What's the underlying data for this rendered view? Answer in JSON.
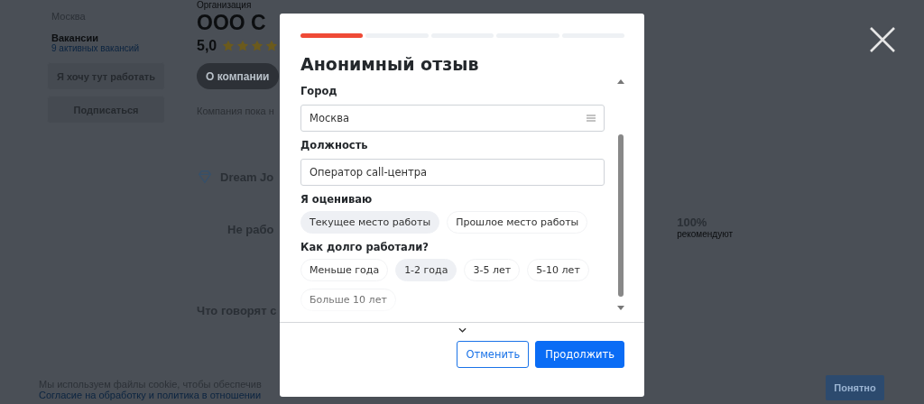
{
  "page": {
    "sidebar": {
      "city": "Москва",
      "vacancies_label": "Вакансии",
      "vacancies_link": "9 активных вакансий",
      "buttons": [
        "Я хочу тут работать",
        "Подписаться"
      ]
    },
    "company": {
      "org_label": "Организация",
      "name": "ООО С",
      "rating": "5,0",
      "stars": 4,
      "tab": "О компании",
      "about": "Компания пока н",
      "dream_job": "Dream Jo",
      "stat_text": "Не рабо",
      "stat_value": "100%",
      "stat_caption": "рекомендуют",
      "reviews_heading": "Что говорят с"
    },
    "cookie": {
      "text": "Мы используем файлы cookie, чтобы обеспечив",
      "link": "Согласие на обработку и политика в отношении",
      "button": "Понятно"
    }
  },
  "modal": {
    "steps": [
      {
        "done": true
      },
      {
        "done": false
      },
      {
        "done": false
      },
      {
        "done": false
      },
      {
        "done": false
      }
    ],
    "title": "Анонимный отзыв",
    "fields": [
      {
        "kind": "select",
        "label": "Город",
        "value": "Москва"
      },
      {
        "kind": "text",
        "label": "Должность",
        "value": "Оператор call-центра"
      }
    ],
    "groups": [
      {
        "label": "Я оцениваю",
        "options": [
          {
            "label": "Текущее место работы",
            "selected": true
          },
          {
            "label": "Прошлое место работы",
            "selected": false
          }
        ]
      },
      {
        "label": "Как долго работали?",
        "options": [
          {
            "label": "Меньше года",
            "selected": false
          },
          {
            "label": "1-2 года",
            "selected": true
          },
          {
            "label": "3-5 лет",
            "selected": false
          },
          {
            "label": "5-10 лет",
            "selected": false
          },
          {
            "label": "Больше 10 лет",
            "selected": false
          }
        ]
      }
    ],
    "cancel": "Отменить",
    "continue": "Продолжить"
  }
}
